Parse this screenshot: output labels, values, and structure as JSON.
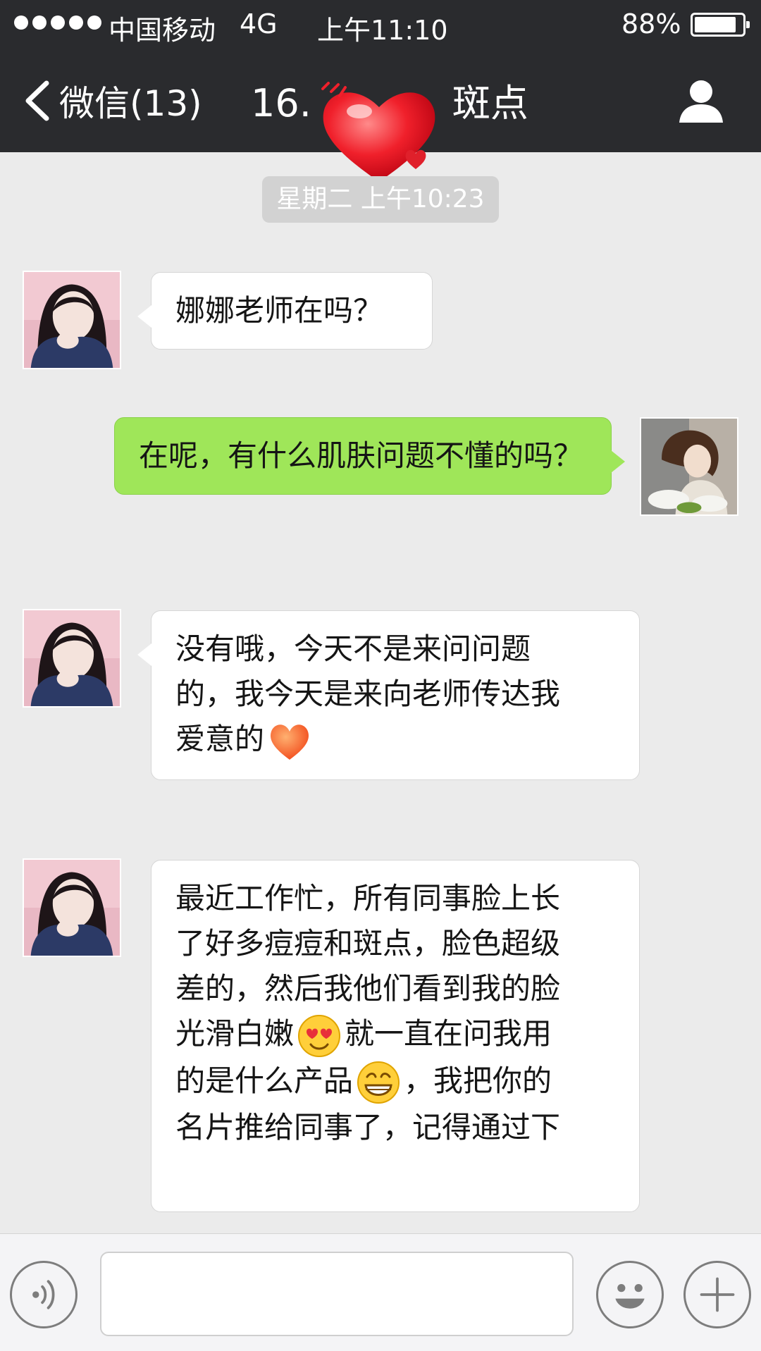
{
  "status_bar": {
    "carrier": "中国移动",
    "network": "4G",
    "time": "上午11:10",
    "battery": "88%",
    "battery_level": 0.88
  },
  "nav": {
    "back_label": "微信(13)",
    "title_left": "16.",
    "title_right": "斑点",
    "back_icon": "chevron-left-icon",
    "profile_icon": "user-icon"
  },
  "chat": {
    "timestamp": "星期二 上午10:23",
    "messages": [
      {
        "sender": "contact",
        "text": "娜娜老师在吗？"
      },
      {
        "sender": "me",
        "text": "在呢，有什么肌肤问题不懂的吗？"
      },
      {
        "sender": "contact",
        "text_lines": [
          "没有哦，今天不是来问问题",
          "的，我今天是来向老师传达我",
          "爱意的"
        ],
        "emoji": "heart-emoji"
      },
      {
        "sender": "contact",
        "line1": "最近工作忙，所有同事脸上长",
        "line2": "了好多痘痘和斑点，脸色超级",
        "line3": "差的，然后我他们看到我的脸",
        "line4a": "光滑白嫩",
        "line4b": "就一直在问我用",
        "line5a": "的是什么产品",
        "line5b": "，我把你的",
        "line6": "名片推给同事了，记得通过下",
        "emojis": [
          "heart-eyes-emoji",
          "grin-emoji"
        ]
      }
    ]
  },
  "input_bar": {
    "voice_icon": "voice-icon",
    "emoji_icon": "smiley-icon",
    "plus_icon": "plus-icon",
    "placeholder": ""
  },
  "colors": {
    "header_bg": "#2a2b2e",
    "chat_bg": "#ebebeb",
    "incoming_bubble": "#ffffff",
    "outgoing_bubble": "#9fe659"
  }
}
